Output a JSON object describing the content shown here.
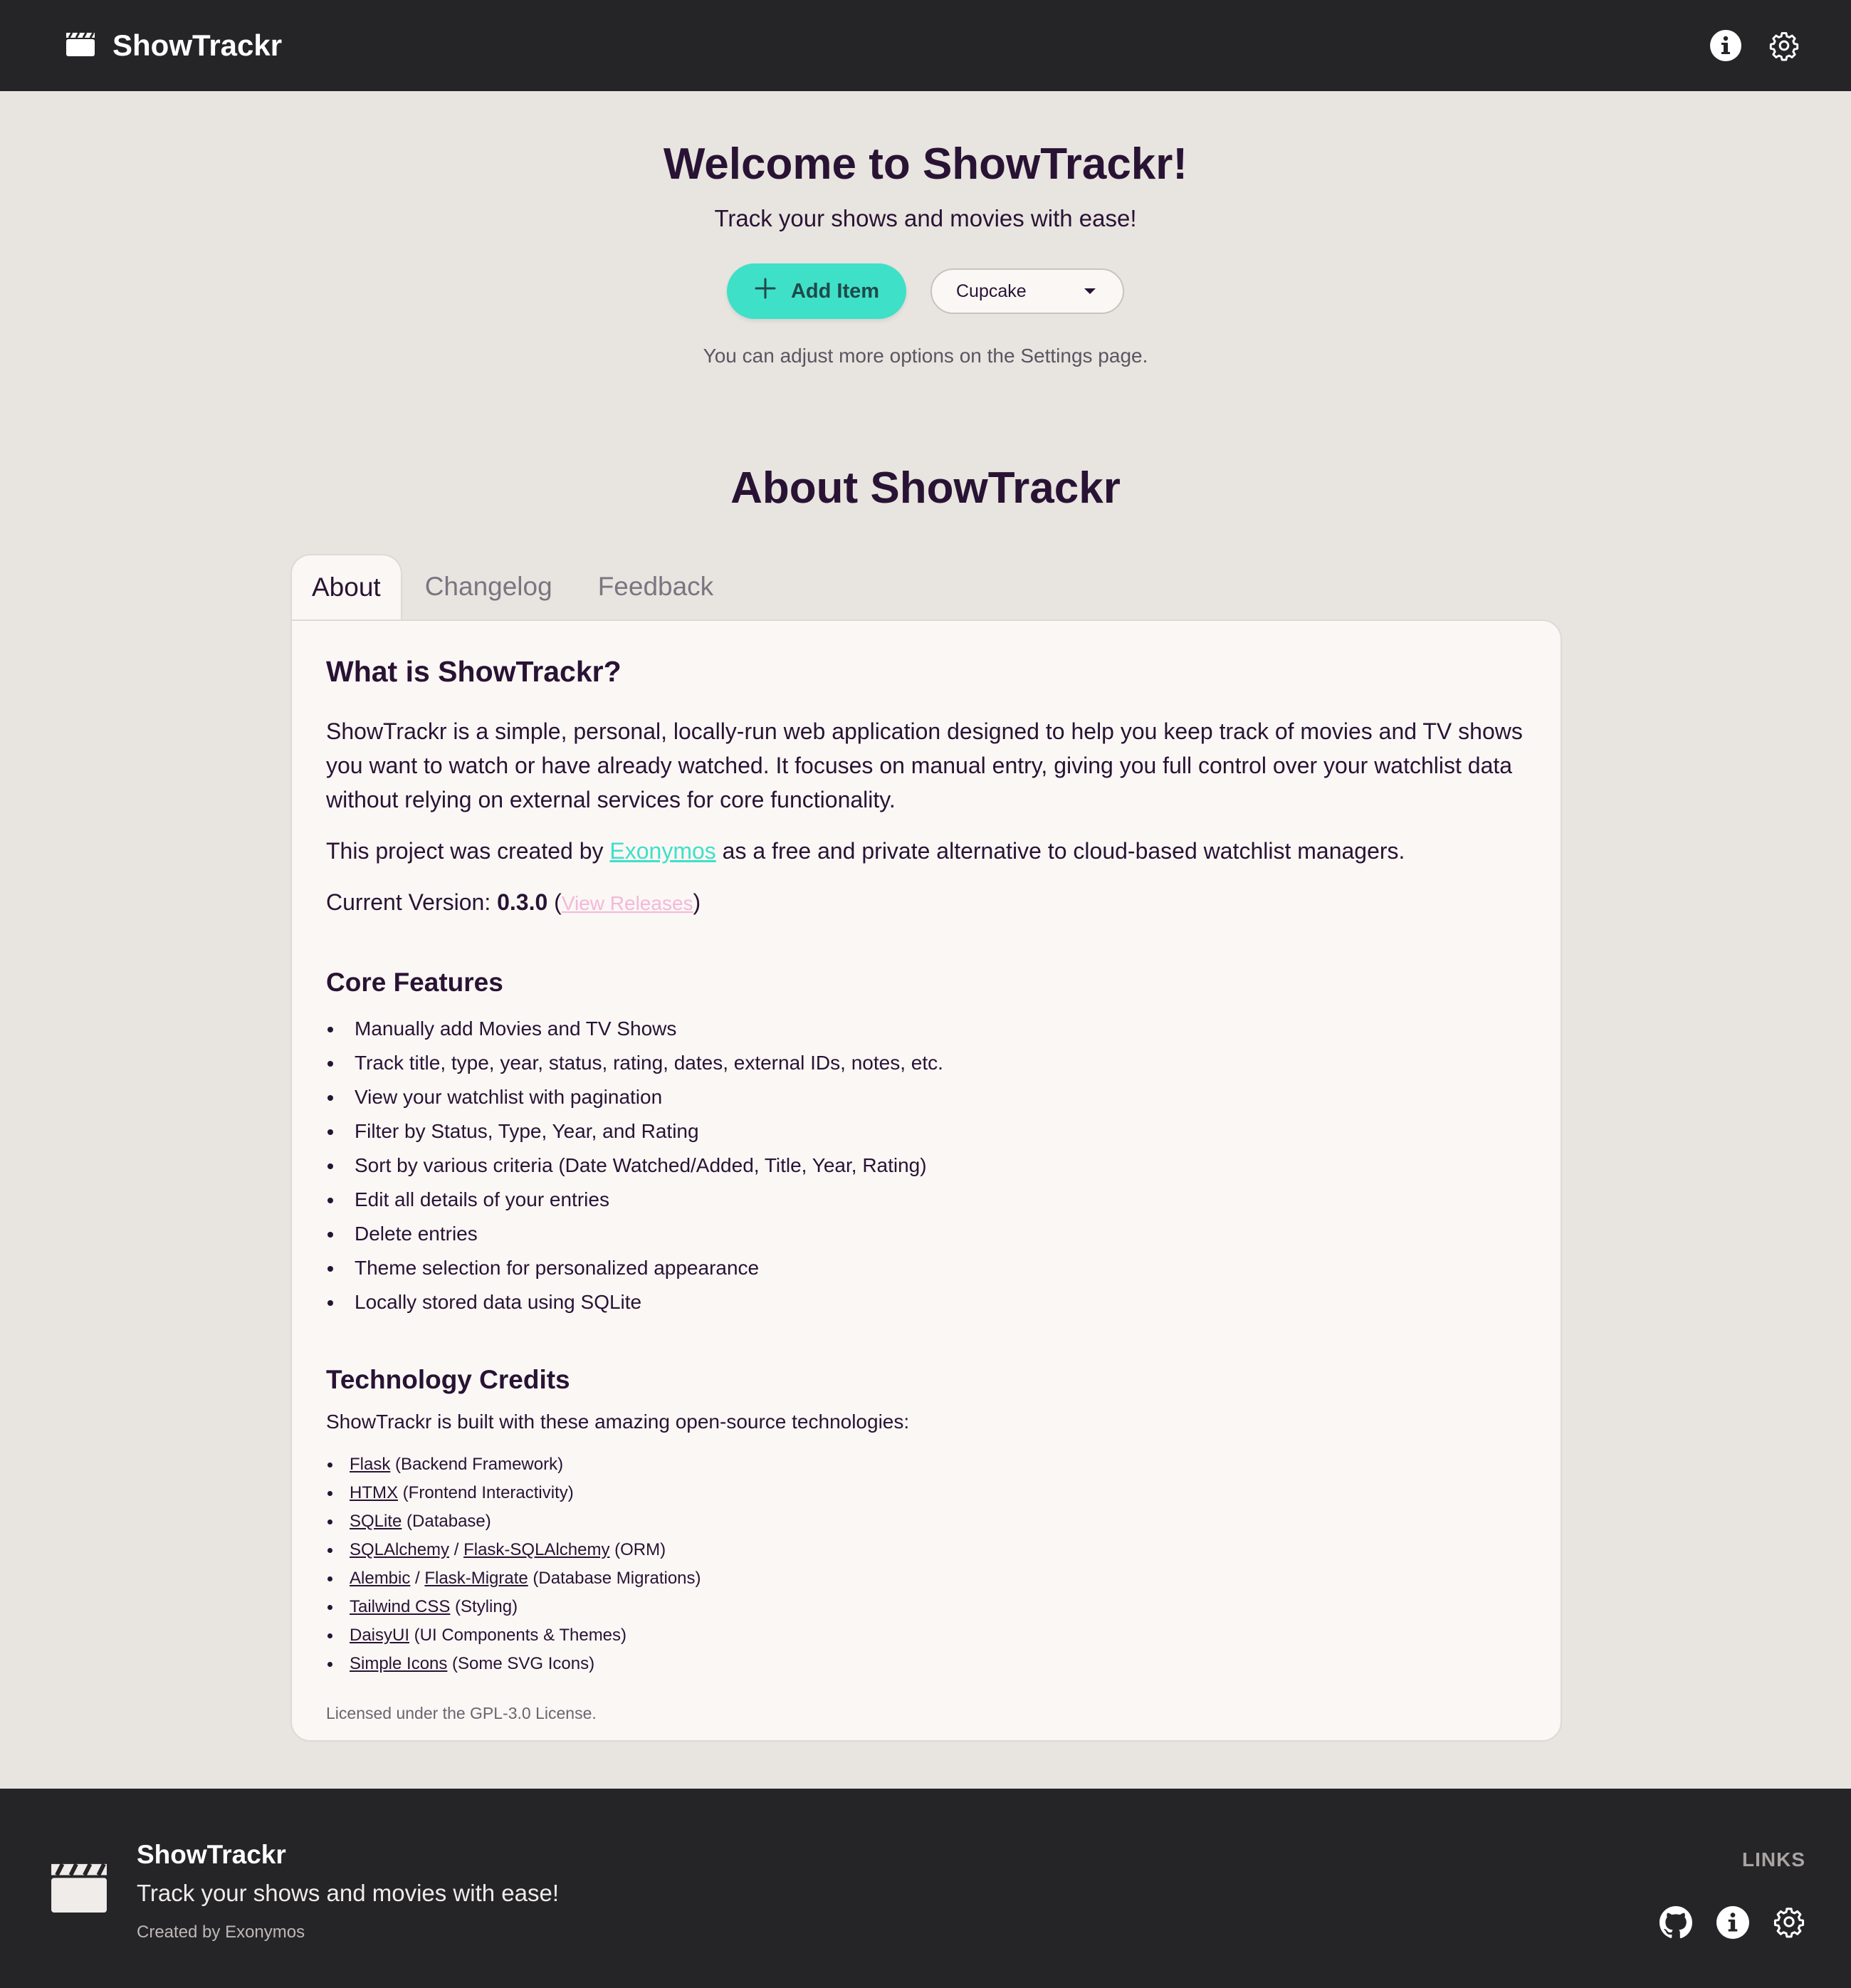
{
  "navbar": {
    "brand": "ShowTrackr",
    "icons": [
      "clapperboard-icon",
      "info-icon",
      "gear-icon"
    ]
  },
  "hero": {
    "title": "Welcome to ShowTrackr!",
    "subtitle": "Track your shows and movies with ease!",
    "add_button": "Add Item",
    "theme_value": "Cupcake",
    "note": "You can adjust more options on the Settings page."
  },
  "about": {
    "title": "About ShowTrackr",
    "tabs": [
      "About",
      "Changelog",
      "Feedback"
    ],
    "active_tab": "About",
    "what_heading": "What is ShowTrackr?",
    "what_body": "ShowTrackr is a simple, personal, locally-run web application designed to help you keep track of movies and TV shows you want to watch or have already watched. It focuses on manual entry, giving you full control over your watchlist data without relying on external services for core functionality.",
    "created_prefix": "This project was created by ",
    "created_link": "Exonymos",
    "created_suffix": " as a free and private alternative to cloud-based watchlist managers.",
    "version_label": "Current Version: ",
    "version": "0.3.0",
    "releases_link": "View Releases",
    "features_heading": "Core Features",
    "features": [
      "Manually add Movies and TV Shows",
      "Track title, type, year, status, rating, dates, external IDs, notes, etc.",
      "View your watchlist with pagination",
      "Filter by Status, Type, Year, and Rating",
      "Sort by various criteria (Date Watched/Added, Title, Year, Rating)",
      "Edit all details of your entries",
      "Delete entries",
      "Theme selection for personalized appearance",
      "Locally stored data using SQLite"
    ],
    "tech_heading": "Technology Credits",
    "tech_intro": "ShowTrackr is built with these amazing open-source technologies:",
    "tech": [
      {
        "links": [
          "Flask"
        ],
        "desc": " (Backend Framework)"
      },
      {
        "links": [
          "HTMX"
        ],
        "desc": " (Frontend Interactivity)"
      },
      {
        "links": [
          "SQLite"
        ],
        "desc": " (Database)"
      },
      {
        "links": [
          "SQLAlchemy",
          "Flask-SQLAlchemy"
        ],
        "desc": " (ORM)"
      },
      {
        "links": [
          "Alembic",
          "Flask-Migrate"
        ],
        "desc": " (Database Migrations)"
      },
      {
        "links": [
          "Tailwind CSS"
        ],
        "desc": " (Styling)"
      },
      {
        "links": [
          "DaisyUI"
        ],
        "desc": " (UI Components & Themes)"
      },
      {
        "links": [
          "Simple Icons"
        ],
        "desc": " (Some SVG Icons)"
      }
    ],
    "license": "Licensed under the GPL-3.0 License."
  },
  "footer": {
    "name": "ShowTrackr",
    "tagline": "Track your shows and movies with ease!",
    "created": "Created by Exonymos",
    "links_title": "LINKS",
    "icons": [
      "github-icon",
      "info-icon",
      "gear-icon"
    ]
  },
  "colors": {
    "accent": "#3fe0c8",
    "navbar": "#252528",
    "background": "#e8e4e0",
    "card": "#faf7f5",
    "text": "#291334",
    "pink": "#f4b8d8"
  }
}
